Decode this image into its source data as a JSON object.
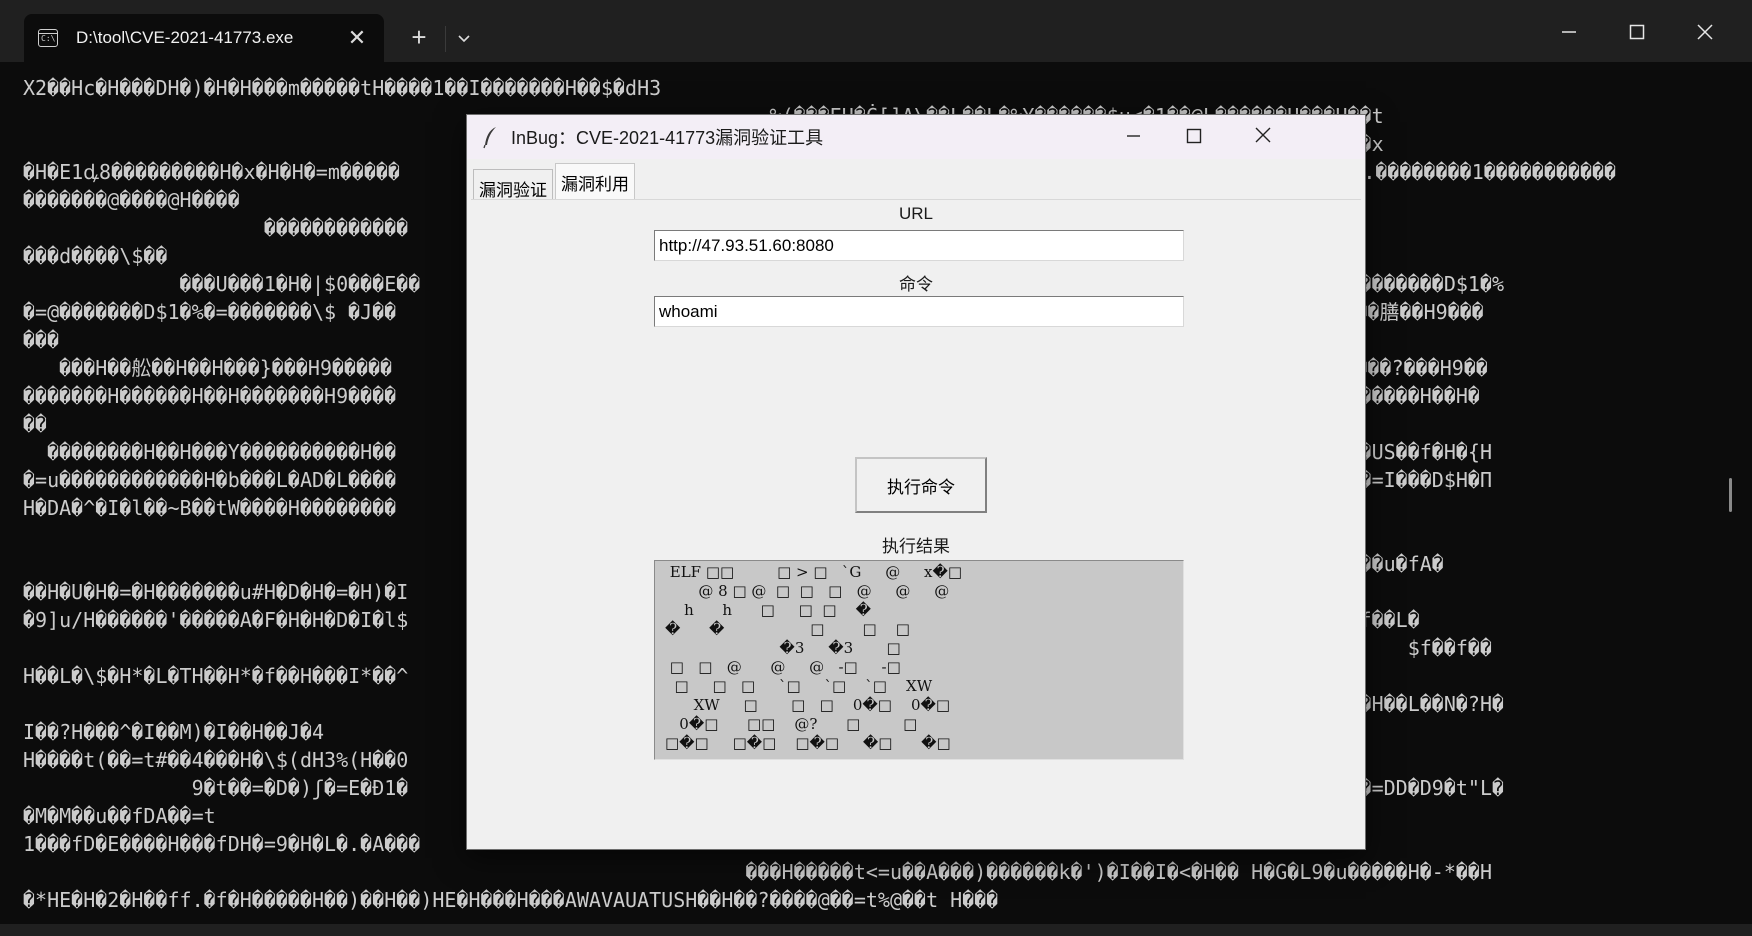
{
  "terminal": {
    "tab_title": "D:\\tool\\CVE-2021-41773.exe",
    "icon_text": "C:\\",
    "icons": {
      "tab": "terminal-icon",
      "close_tab": "close-icon",
      "new_tab": "plus-icon",
      "dropdown": "chevron-down-icon",
      "minimize": "minimize-icon",
      "maximize": "maximize-icon",
      "close": "close-icon"
    },
    "tab_close_glyph": "✕",
    "new_tab_glyph": "+",
    "output": "X2��Hc�H���DH�)�H�H���m�����tH����1��I�������H��$�dH3\n                                                              %(���EH�Ċ[]A\\��L��L�%Y������$u<�1��@L������H���H��t\n                                                                                                              f�x\n�H�E1ꝱ8���������H�x�H�H�=m�����                                                                              �f.��������1�����������\n�������@����@H����\n                    ������������\n���d����\\$��\n             ���U���1�H�|$0���E��                                                                   ���D$1�%�= �������D$1�%\n�=@�������D$1�%�=�������\\$ �J��                                                                   ��H��詣��H��H��膳��H9���\n���\n   ���H��舩��H��H���}���H9�����                                                                   �H���%���H��H���?���H9��\n�������H������H��H�������H9����                                                                   ���H��H�����������H��H�\n��\n  ��������H��H���Y����������H��                                                                   AV��AUE1�ATE1�US��f�H�{H\n�=u������������H�b���L�AD�L����                                                                   I��USH��H��:[�=I���D$H�Π\nH�DA�^�I�l��~B��tW����H��������                                                                   \n                                                                                                   7H��tL���\n                                                                                                            �����u�fA�\n��H�U�H�=�H�������u#H�D�H�=�H)�I\n�9]u/H������'�����A�F�H�H�D�I�l$                                                                   ��H���������f��L�\n                                                                                                                   $f��f��\nH��L�\\$�H*�L�TH��H*�f��H���I*��^\n                                                                                                   ��^�H��L)�I��H��L��N�?H�\nI��?H���^�I��M)�I��H��J�4\nH����t(��=t#��4���H�\\$(dH3%(H��0\n              9�t��=�D�)ʃ�=E�Đ1�                                                                   D�D9�t��=tA��=DD�D9�t\"L�\n�M�M��u��fDA��=t\n1���fD�E����H���fDH�=9�H�L�.�A���\n                                                            ���H�����t<=u��A���)������k�')�I��I�<�H�� H�G�L9�u�����H�-*��H\n�*HE�H�2�H��ff.�f�H�����H��)��H��)HE�H���H���AWAVAUATUSH��H��?����@��=t%@��t H���"
  },
  "dialog": {
    "title": "InBug：CVE-2021-41773漏洞验证工具",
    "icons": {
      "app": "feather-icon",
      "minimize": "minimize-icon",
      "maximize": "maximize-icon",
      "close": "close-icon"
    },
    "tabs": [
      {
        "label": "漏洞验证",
        "active": false
      },
      {
        "label": "漏洞利用",
        "active": true
      }
    ],
    "url_label": "URL",
    "url_value": "http://47.93.51.60:8080",
    "command_label": "命令",
    "command_value": "whoami",
    "execute_button": "执行命令",
    "result_label": "执行结果",
    "result_text": " ELF □□         □ > □   `G     @     x�□\n       @ 8 □ @  □  □   □   @     @     @\n    h      h      □     □  □    �\n�      �                  □        □    □\n                        �3     �3       □\n □   □   @      @     @   -□     -□\n  □     □   □     `□     `□    `□    XW\n      XW     □       □   □    0�□    0�□\n   0�□      □□    @?      □         □\n□�□     □�□    □�□     �□      �□",
    "colors": {
      "terminal_bg": "#0c0c0c",
      "terminal_text": "#cccccc",
      "dialog_bg": "#f0f0f0",
      "dialog_titlebar": "#f3eef6",
      "result_bg": "#c8c8c8"
    }
  }
}
